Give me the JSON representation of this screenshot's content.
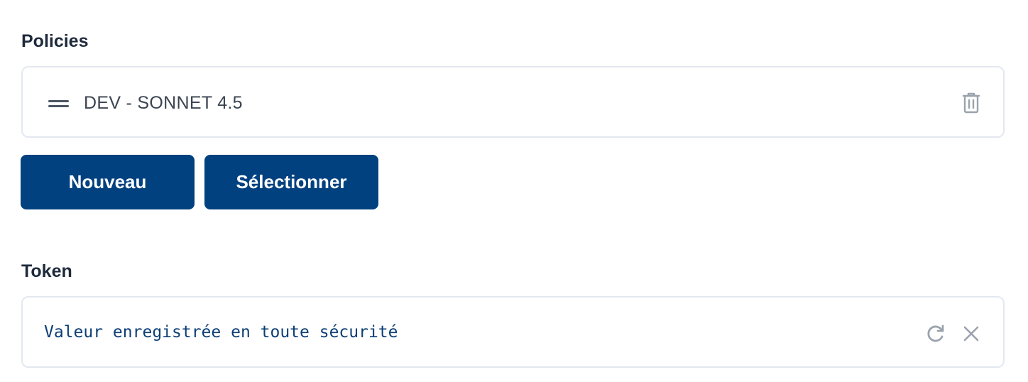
{
  "policies": {
    "label": "Policies",
    "items": [
      {
        "name": "DEV - SONNET 4.5",
        "icons": [
          "drag-handle-icon",
          "trash-icon"
        ]
      }
    ],
    "buttons": {
      "new_label": "Nouveau",
      "select_label": "Sélectionner"
    }
  },
  "token": {
    "label": "Token",
    "value": "Valeur enregistrée en toute sécurité",
    "icons": [
      "refresh-icon",
      "close-icon"
    ]
  },
  "colors": {
    "primary_button": "#02417f",
    "label_text": "#1e2a3b",
    "token_text": "#0c3f76",
    "border": "#e3e8f0",
    "icon_muted": "#9aa3ad"
  }
}
